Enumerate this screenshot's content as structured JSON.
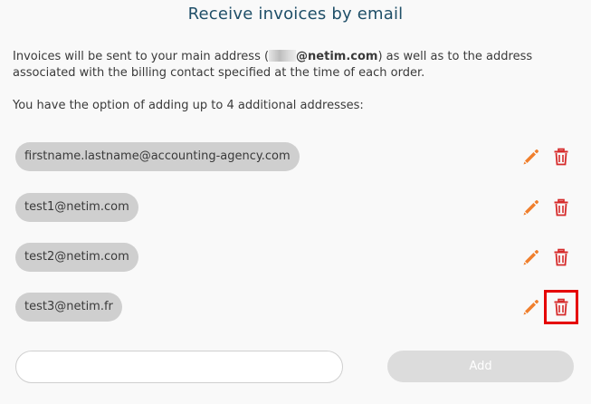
{
  "title": "Receive invoices by email",
  "intro": {
    "before": "Invoices will be sent to your main address (",
    "domain": "@netim.com",
    "after": ") as well as to the address associated with the billing contact specified at the time of each order."
  },
  "option_text": "You have the option of adding up to 4 additional addresses:",
  "addresses": [
    "firstname.lastname@accounting-agency.com",
    "test1@netim.com",
    "test2@netim.com",
    "test3@netim.fr"
  ],
  "new_address": {
    "value": "",
    "placeholder": ""
  },
  "add_label": "Add",
  "colors": {
    "title": "#1f4f68",
    "edit_icon": "#f07f2d",
    "delete_icon": "#d62b2b",
    "highlight": "#e50000",
    "pill": "#cfcfcf"
  },
  "icons": {
    "edit": "pencil-icon",
    "delete": "trash-icon"
  }
}
